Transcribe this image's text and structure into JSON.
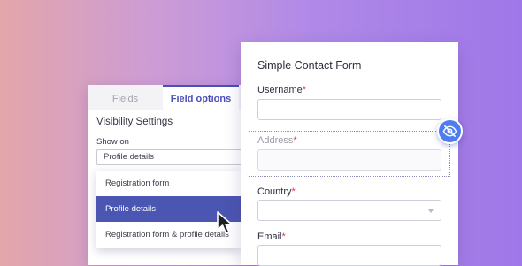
{
  "settings": {
    "tabs": [
      {
        "label": "Fields",
        "active": false
      },
      {
        "label": "Field options",
        "active": true
      }
    ],
    "section_title": "Visibility Settings",
    "show_on_label": "Show on",
    "selected_value": "Profile details",
    "options": [
      {
        "label": "Registration form"
      },
      {
        "label": "Profile details",
        "selected": true
      },
      {
        "label": "Registration form & profile details"
      }
    ]
  },
  "form": {
    "title": "Simple Contact Form",
    "required_mark": "*",
    "fields": {
      "username": {
        "label": "Username"
      },
      "address": {
        "label": "Address",
        "hidden": true
      },
      "country": {
        "label": "Country",
        "type": "select"
      },
      "email": {
        "label": "Email"
      }
    }
  },
  "icons": {
    "visibility_toggle": "eye-slash-icon",
    "cursor": "mouse-pointer-icon"
  },
  "colors": {
    "accent": "#4b4fb8",
    "selected_option": "#4b56b2",
    "badge": "#4d7df0",
    "required": "#d6405b"
  }
}
